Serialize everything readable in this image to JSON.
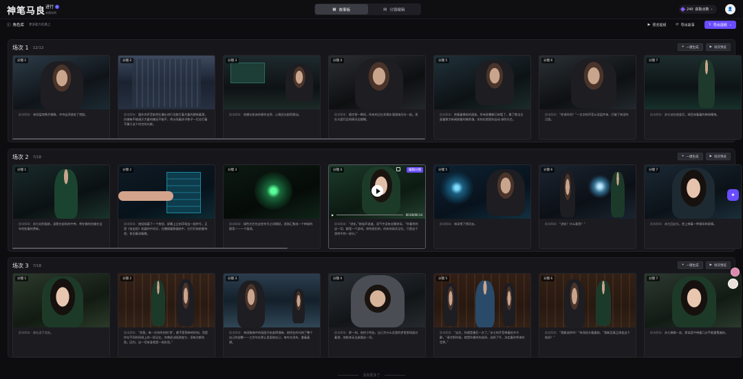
{
  "app": {
    "logo": "神笔马良",
    "project_name": "进行",
    "project_badge": "✓",
    "project_sub": "未保存的"
  },
  "view_toggle": {
    "storyboard": "故事板",
    "split_view": "分镜编辑"
  },
  "credits": {
    "value": "240",
    "label": "获取点数",
    "chev": "›"
  },
  "user": {
    "avatar": "👤"
  },
  "role_library": {
    "label": "角色库",
    "hint": "更多能力在路上"
  },
  "top_actions": {
    "pre_edit": "预览视频",
    "import": "导出故事",
    "export": "导出视频"
  },
  "scene_actions": {
    "generate_all": "一键生成",
    "preview": "场次预览"
  },
  "desc_label": "剧本脚本：",
  "scenes": [
    {
      "title": "场次 1",
      "count": "12/12",
      "shots": [
        {
          "tag": "分镜 1",
          "desc": "林深猛地睁开眼睛，冲冲出浮就进了宫脏。"
        },
        {
          "tag": "分镜 2",
          "desc": "窗外的声音依然在漏水进行功能打着大着的建筑着落，仿佛每不能避灭大着的棚还不能不，将水雨着孩子数子一灯应灯着不属于这个时空的光辉。"
        },
        {
          "tag": "分镜 3",
          "desc": "他躺在机床的操作台旁，心跳还在剧烈跳动。"
        },
        {
          "tag": "分镜 4",
          "desc": "随才那一瞬间，所有的记忆如潮水涌涌来历在一起。现在与渡们至的情况全都糊。"
        },
        {
          "tag": "分镜 5",
          "desc": "他看着操纵的面板，所有屏幕都已碎裂了，最了数法全面着数字新闻刚看的微弥漫，如何在熙熙的自动 绿色光芒。"
        },
        {
          "tag": "分镜 6",
          "desc": "“你说时间？”一次次的声音从深层传来，打破了林深的沉思。"
        },
        {
          "tag": "分镜 7",
          "desc": "苏七站在他身后，绿目穿着着的带绿睡袍。"
        }
      ]
    },
    {
      "title": "场次 2",
      "count": "7/18",
      "shots": [
        {
          "tag": "分镜 1",
          "desc": "苏七站到面前，身影在部机的中央，将在微的仿佛在当年的些着的更新。"
        },
        {
          "tag": "分镜 2",
          "desc": "她轻轻着下一个按钮，屏幕上立刻浮现出一组符号，正是《虫出现》机器的中间文，在播操着数据结中，它们开始前都持程，依旧着流着搬。"
        },
        {
          "tag": "分镜 3",
          "desc": "绿色光芒在这些符号之间跳跃，逐渐汇聚成一个神秘的图案——一个漩涡。"
        },
        {
          "tag": "分镜 4",
          "desc": "“进化，”她轻声说道，语气中没有丝毫惊讶。“你看到的这一切，都是一个游戏。你所经历的，所有的现实记忆，只是这个游戏中的一部分。”",
          "selected": true,
          "video": "00:00/00:14",
          "badge": "编辑分镜"
        },
        {
          "tag": "分镜 5",
          "desc": "林深愣了愣问去。"
        },
        {
          "tag": "分镜 6",
          "desc": "“进化？什么意思？”"
        },
        {
          "tag": "分镜 7",
          "desc": "苏七回过头，脸上带着一种莫如的表情。"
        }
      ]
    },
    {
      "title": "场次 3",
      "count": "7/18",
      "shots": [
        {
          "tag": "分镜 1",
          "desc": "苏七点了点头。"
        },
        {
          "tag": "分镜 2",
          "desc": "“如我，每一次你所的的‘梦’，都不是简单的时刻，而是你在不同时间线上的一段记忆。你曾经试图改变它，但每次都失败。因为，这一切本身就是一场实验。”"
        },
        {
          "tag": "分镜 3",
          "desc": "林深脑海中的画面开始变得清晰，他所在的乌和了整个自己的部整——三岁年在那让里面他自己，每年在消失，重着着想。"
        },
        {
          "tag": "分镜 4",
          "desc": "那一刻，他终于明白，自己为什么总是的梦里那场面对着侵，他根本无法逃脱这一切。"
        },
        {
          "tag": "分镜 5",
          "desc": "“这次，你就是最后一次了。”苏七的声音带着些许冷静，“请才那时候，就是你最终的选择。选择了坏，决定着你将来的世界。”"
        },
        {
          "tag": "分镜 6",
          "desc": "“我都选择吗？”林深轻头看着她，“我能否真正改变这个结局？”"
        },
        {
          "tag": "分镜 7",
          "desc": "苏七微微一笑，那笑容中带着几分不能重置遍执。"
        }
      ]
    }
  ],
  "footer": "没有更多了",
  "floater": "✦"
}
